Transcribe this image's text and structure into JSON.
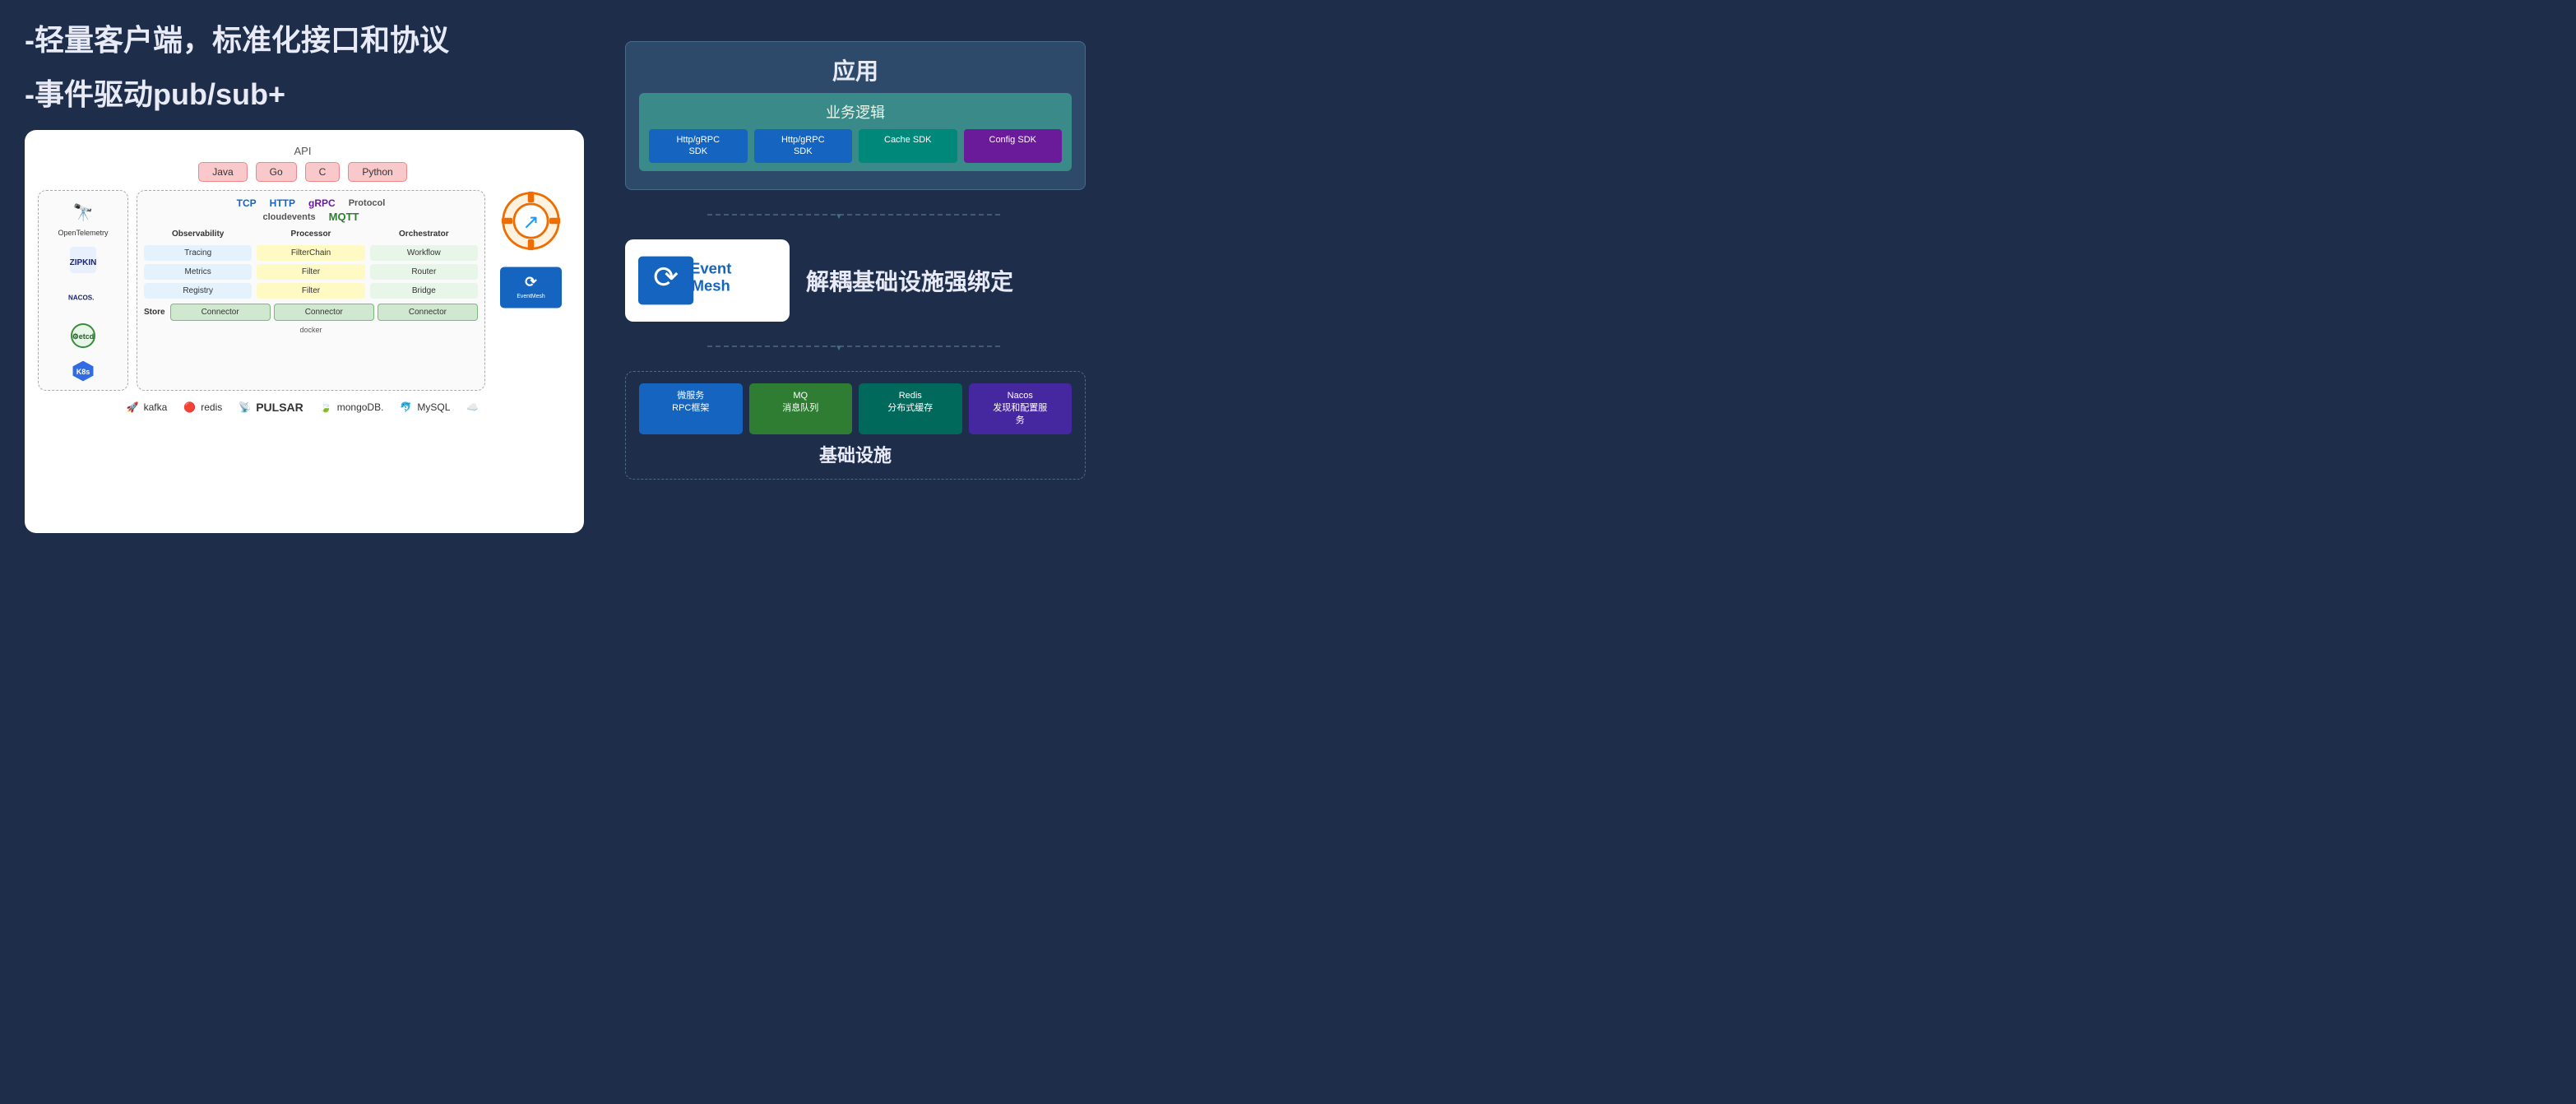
{
  "headlines": {
    "line1": "-轻量客户端，标准化接口和协议",
    "line2": "-事件驱动pub/sub+"
  },
  "arch": {
    "api_label": "API",
    "api_buttons": [
      "Java",
      "Go",
      "C",
      "Python"
    ],
    "protocols": {
      "tcp": "TCP",
      "http": "HTTP",
      "grpc": "gRPC",
      "cloudevents": "cloudevents",
      "mqtt": "MQTT",
      "label": "Protocol"
    },
    "columns": {
      "observability": {
        "header": "Observability",
        "items": [
          "Tracing",
          "Metrics",
          "Registry"
        ]
      },
      "processor": {
        "header": "Processor",
        "items": [
          "FilterChain",
          "Filter",
          "Filter"
        ]
      },
      "orchestrator": {
        "header": "Orchestrator",
        "items": [
          "Workflow",
          "Router",
          "Bridge"
        ]
      }
    },
    "store": {
      "label": "Store",
      "connectors": [
        "Connector",
        "Connector",
        "Connector"
      ]
    },
    "logos": {
      "left": [
        {
          "name": "OpenTelemetry",
          "symbol": "🔭"
        },
        {
          "name": "ZIPKIN",
          "symbol": "⚡"
        },
        {
          "name": "NACOS",
          "symbol": "🔷"
        },
        {
          "name": "etcd",
          "symbol": "⚙️"
        }
      ]
    },
    "infra": [
      {
        "name": "kafka",
        "symbol": "🚀"
      },
      {
        "name": "redis",
        "symbol": "🔴"
      },
      {
        "name": "PULSAR",
        "symbol": "📡"
      },
      {
        "name": "mongoDB.",
        "symbol": "🍃"
      },
      {
        "name": "MySQL",
        "symbol": "🐬"
      },
      {
        "name": "cloud",
        "symbol": "☁️"
      }
    ]
  },
  "right": {
    "app": {
      "title": "应用",
      "logic_title": "业务逻辑",
      "sdks": [
        {
          "label": "Http/gRPC\nSDK",
          "color": "blue"
        },
        {
          "label": "Http/gRPC\nSDK",
          "color": "blue"
        },
        {
          "label": "Cache SDK",
          "color": "teal"
        },
        {
          "label": "Config SDK",
          "color": "purple"
        }
      ]
    },
    "eventmesh": {
      "brand": "EventMesh",
      "tagline": "解耦基础设施强绑定"
    },
    "infra": {
      "title": "基础设施",
      "items": [
        {
          "label": "微服务\nRPC框架",
          "color": "blue"
        },
        {
          "label": "MQ\n消息队列",
          "color": "green"
        },
        {
          "label": "Redis\n分布式缓存",
          "color": "teal"
        },
        {
          "label": "Nacos\n发现和配置服\n务",
          "color": "purple"
        }
      ]
    }
  }
}
